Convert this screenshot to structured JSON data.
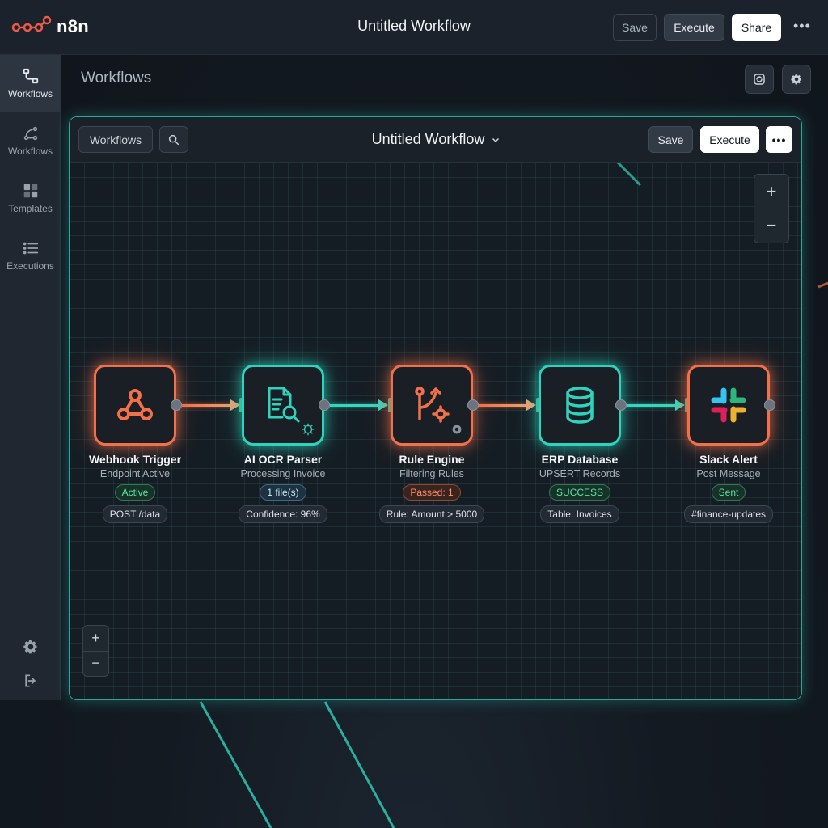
{
  "app": {
    "brand": "n8n",
    "title": "Untitled Workflow"
  },
  "top_actions": {
    "save": "Save",
    "execute": "Execute",
    "share": "Share",
    "more": "•••"
  },
  "sidebar": {
    "items": [
      {
        "label": "Workflows",
        "icon": "workflow-icon",
        "active": true
      },
      {
        "label": "Workflows",
        "icon": "branch-icon",
        "active": false
      },
      {
        "label": "Templates",
        "icon": "templates-icon",
        "active": false
      },
      {
        "label": "Executions",
        "icon": "list-icon",
        "active": false
      }
    ],
    "bottom": [
      "settings-icon",
      "logout-icon"
    ]
  },
  "page": {
    "title": "Workflows"
  },
  "editor": {
    "breadcrumb": "Workflows",
    "title": "Untitled Workflow",
    "save": "Save",
    "execute": "Execute",
    "more": "•••",
    "zoom_in": "+",
    "zoom_out": "−"
  },
  "nodes": [
    {
      "name": "Webhook Trigger",
      "subtitle": "Endpoint Active",
      "status": "Active",
      "detail": "POST /data",
      "icon": "webhook-icon",
      "color": "#f2704a"
    },
    {
      "name": "AI OCR Parser",
      "subtitle": "Processing Invoice",
      "status": "1 file(s)",
      "detail": "Confidence: 96%",
      "icon": "document-scan-icon",
      "color": "#2ed3bd"
    },
    {
      "name": "Rule Engine",
      "subtitle": "Filtering Rules",
      "status": "Passed: 1",
      "detail": "Rule: Amount > 5000",
      "icon": "branch-rules-icon",
      "color": "#f2704a"
    },
    {
      "name": "ERP Database",
      "subtitle": "UPSERT Records",
      "status": "SUCCESS",
      "detail": "Table: Invoices",
      "icon": "database-icon",
      "color": "#2ed3bd"
    },
    {
      "name": "Slack Alert",
      "subtitle": "Post Message",
      "status": "Sent",
      "detail": "#finance-updates",
      "icon": "slack-icon",
      "color": "#f2704a"
    }
  ]
}
